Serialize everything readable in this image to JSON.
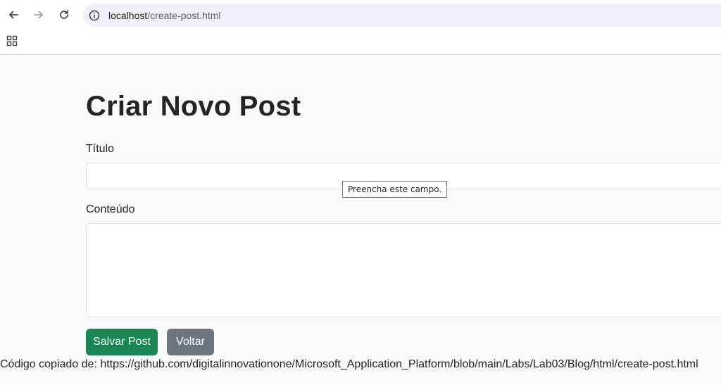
{
  "browser": {
    "url_host": "localhost",
    "url_path": "/create-post.html",
    "icons": {
      "back": "back-arrow-icon",
      "forward": "forward-arrow-icon",
      "reload": "reload-icon",
      "site_info": "site-info-icon",
      "apps": "apps-grid-icon"
    }
  },
  "page": {
    "title": "Criar Novo Post",
    "form": {
      "title_label": "Título",
      "title_value": "",
      "content_label": "Conteúdo",
      "content_value": "",
      "validation_tooltip": "Preencha este campo.",
      "save_label": "Salvar Post",
      "back_label": "Voltar"
    },
    "footer_note": "Código copiado de: https://github.com/digitalinnovationone/Microsoft_Application_Platform/blob/main/Labs/Lab03/Blog/html/create-post.html"
  },
  "colors": {
    "save_button": "#198754",
    "back_button": "#6c757d",
    "page_background": "#f8f9fa",
    "omnibox_background": "#eef1f7"
  }
}
